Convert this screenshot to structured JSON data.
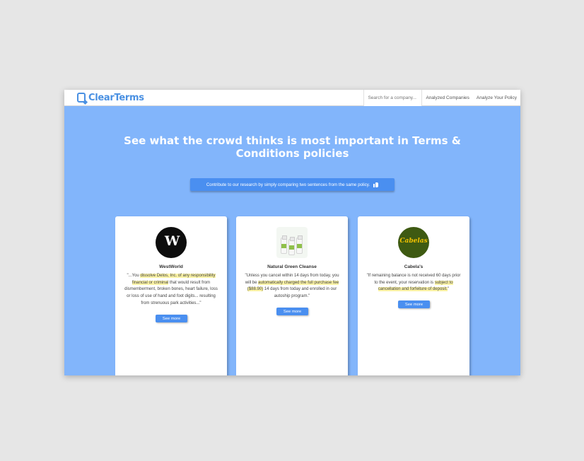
{
  "header": {
    "brand": "ClearTerms",
    "search_placeholder": "Search for a company...",
    "nav": [
      "Analyzed Companies",
      "Analyze Your Policy"
    ]
  },
  "hero": {
    "title_line1": "See what the crowd thinks is most important in Terms &",
    "title_line2": "Conditions policies",
    "cta_label": "Contribute to our research by simply comparing two sentences from the same policy.",
    "cta_icon": "thumbs-up-icon"
  },
  "cards": [
    {
      "name": "WestWorld",
      "logo": "westworld-logo",
      "quote_pre": "\"...You ",
      "quote_hl": "dissolve Delos, Inc. of any responsibility financial or criminal",
      "quote_post": " that would result from dismemberment, broken bones, heart failure, loss or loss of use of hand and foot digits... resulting from strenuous park activities...\"",
      "button": "See more"
    },
    {
      "name": "Natural Green Cleanse",
      "logo": "supplement-bottles-logo",
      "quote_pre": "\"Unless you cancel within 14 days from today, you will be ",
      "quote_hl": "automatically charged the full purchase fee ($88.90)",
      "quote_post": " 14 days from today and enrolled in our autoship program.\"",
      "button": "See more"
    },
    {
      "name": "Cabela's",
      "logo": "cabelas-logo",
      "logo_text": "Cabelas",
      "quote_pre": "\"If remaining balance is not received 60 days prior to the event, your reservation is ",
      "quote_hl": "subject to cancellation and forfeiture of deposit.",
      "quote_post": "\"",
      "button": "See more"
    }
  ],
  "colors": {
    "background": "#82b5fb",
    "accent": "#4a8ff0",
    "highlight": "#fbf3a6"
  }
}
